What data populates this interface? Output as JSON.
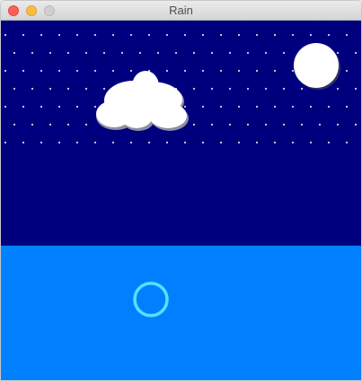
{
  "window": {
    "title": "Rain"
  },
  "icons": {
    "close": "close-circle-icon",
    "minimize": "minimize-circle-icon",
    "zoom": "zoom-circle-icon"
  },
  "colors": {
    "sky": "#00007e",
    "sea": "#0080ff",
    "raindrop": "#ffffff",
    "cloud": "#ffffff",
    "cloud_shadow": "#8a8a9a",
    "moon": "#ffffff",
    "ring": "#55e0ff",
    "close_button": "#fc605b",
    "minimize_button": "#fdbc40",
    "zoom_button": "#d0d0d0"
  }
}
